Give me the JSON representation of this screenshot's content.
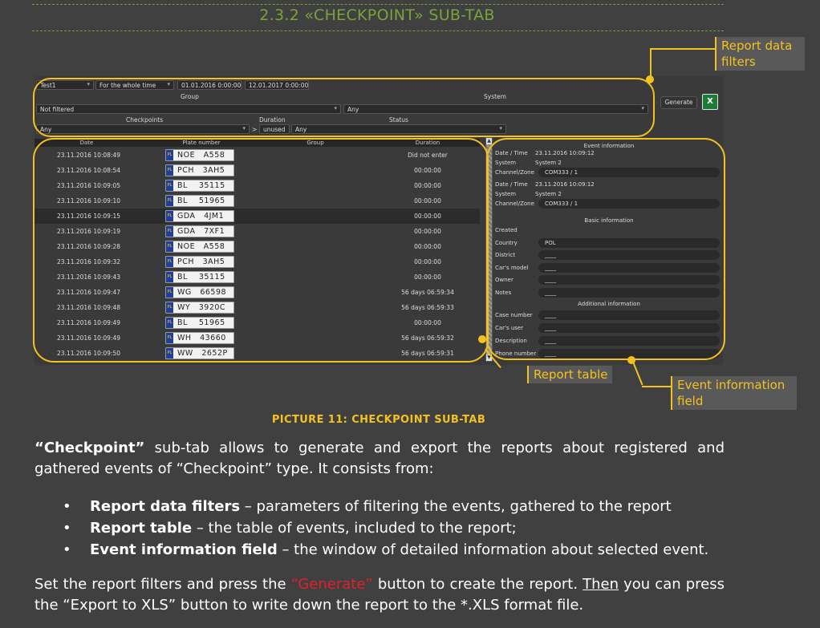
{
  "heading": "2.3.2   «CHECKPOINT» SUB-TAB",
  "screenshot": {
    "filters": {
      "report_name": "Test1",
      "period": "For the whole time",
      "date_from": "01.01.2016 0:00:00",
      "date_to": "12.01.2017 0:00:00",
      "group_label": "Group",
      "group_value": "Not filtered",
      "system_label": "System",
      "system_value": "Any",
      "checkpoints_label": "Checkpoints",
      "checkpoints_value": "Any",
      "duration_label": "Duration",
      "duration_op": ">",
      "duration_value": "unused",
      "status_label": "Status",
      "status_value": "Any",
      "generate_label": "Generate",
      "export_icon_text": "X"
    },
    "table": {
      "headers": [
        "Date",
        "Plate number",
        "Group",
        "Duration"
      ],
      "rows": [
        {
          "date": "23.11.2016 10:08:49",
          "plate": "NOE   A558",
          "duration": "Did not enter"
        },
        {
          "date": "23.11.2016 10:08:54",
          "plate": "PCH   3AH5",
          "duration": "00:00:00"
        },
        {
          "date": "23.11.2016 10:09:05",
          "plate": "BL    35115",
          "duration": "00:00:00"
        },
        {
          "date": "23.11.2016 10:09:10",
          "plate": "BL    51965",
          "duration": "00:00:00"
        },
        {
          "date": "23.11.2016 10:09:15",
          "plate": "GDA   4JM1",
          "duration": "00:00:00"
        },
        {
          "date": "23.11.2016 10:09:19",
          "plate": "GDA   7XF1",
          "duration": "00:00:00"
        },
        {
          "date": "23.11.2016 10:09:28",
          "plate": "NOE   A558",
          "duration": "00:00:00"
        },
        {
          "date": "23.11.2016 10:09:32",
          "plate": "PCH   3AH5",
          "duration": "00:00:00"
        },
        {
          "date": "23.11.2016 10:09:43",
          "plate": "BL    35115",
          "duration": "00:00:00"
        },
        {
          "date": "23.11.2016 10:09:47",
          "plate": "WG   66598",
          "duration": "56 days 06:59:34"
        },
        {
          "date": "23.11.2016 10:09:48",
          "plate": "WY   3920C",
          "duration": "56 days 06:59:33"
        },
        {
          "date": "23.11.2016 10:09:49",
          "plate": "BL    51965",
          "duration": "00:00:00"
        },
        {
          "date": "23.11.2016 10:09:49",
          "plate": "WH   43660",
          "duration": "56 days 06:59:32"
        },
        {
          "date": "23.11.2016 10:09:50",
          "plate": "WW   2652P",
          "duration": "56 days 06:59:31"
        }
      ]
    },
    "event_info": {
      "title": "Event information",
      "entries": [
        {
          "k": "Date / Time",
          "v": "23.11.2016 10:09:12"
        },
        {
          "k": "System",
          "v": "System 2"
        },
        {
          "k": "Channel/Zone",
          "v": "COM333 / 1"
        },
        {
          "k": "Date / Time",
          "v": "23.11.2016 10:09:12"
        },
        {
          "k": "System",
          "v": "System 2"
        },
        {
          "k": "Channel/Zone",
          "v": "COM333 / 1"
        }
      ],
      "basic_title": "Basic information",
      "basic": [
        {
          "k": "Created",
          "v": ""
        },
        {
          "k": "Country",
          "v": "POL"
        },
        {
          "k": "District",
          "v": "____"
        },
        {
          "k": "Car's model",
          "v": "____"
        },
        {
          "k": "Owner",
          "v": "____"
        },
        {
          "k": "Notes",
          "v": "____"
        }
      ],
      "additional_title": "Additional information",
      "additional": [
        {
          "k": "Case number",
          "v": "____"
        },
        {
          "k": "Car's user",
          "v": "____"
        },
        {
          "k": "Description",
          "v": "____"
        },
        {
          "k": "Phone number",
          "v": "____"
        }
      ]
    },
    "callouts": {
      "filters": "Report data filters",
      "table": "Report table",
      "event": "Event information field"
    }
  },
  "caption": "PICTURE 11: CHECKPOINT SUB-TAB",
  "para1": {
    "term": "“Checkpoint”",
    "text": " sub-tab allows to generate and export the reports about registered and gathered events of “Checkpoint” type. It consists from:"
  },
  "bullets": [
    {
      "term": "Report data filters",
      "text": " – parameters of filtering the events, gathered to the report"
    },
    {
      "term": "Report table",
      "text": " – the table of events, included to the report;"
    },
    {
      "term": "Event information field",
      "text": " – the window of detailed information about selected event."
    }
  ],
  "para2": {
    "a": "Set the report filters and press the ",
    "generate": "“Generate”",
    "b": " button to create the report. ",
    "then": "Then",
    "c": " you can press the “Export to XLS” button to write down the report to the *.XLS format file."
  },
  "colors": {
    "background": "#404040",
    "heading": "#7aa33a",
    "accent": "#f4c21f",
    "red": "#e0202a"
  }
}
